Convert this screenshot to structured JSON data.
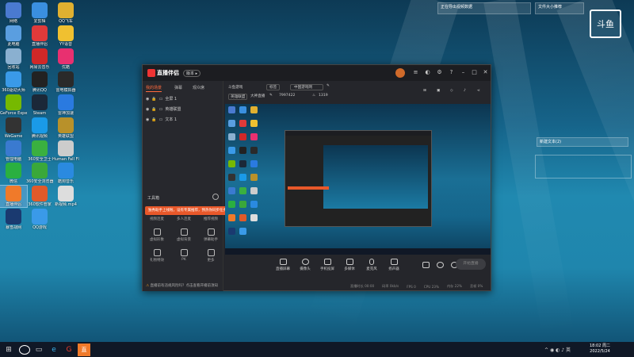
{
  "desktop_icons": [
    {
      "label": "网络",
      "color": "#4a7ad0",
      "glyph": "net"
    },
    {
      "label": "爱剪辑",
      "color": "#3a8fe0",
      "glyph": "剪"
    },
    {
      "label": "QQ飞车",
      "color": "#e0b030",
      "glyph": "Q"
    },
    {
      "label": "此电脑",
      "color": "#5a9ee0",
      "glyph": "pc"
    },
    {
      "label": "直播伴侣",
      "color": "#e03a3a",
      "glyph": "直"
    },
    {
      "label": "YY语音",
      "color": "#f0c030",
      "glyph": "Y"
    },
    {
      "label": "回收站",
      "color": "#8ab0d0",
      "glyph": "bin"
    },
    {
      "label": "网易云音乐",
      "color": "#d02828",
      "glyph": "网"
    },
    {
      "label": "优酷",
      "color": "#e83070",
      "glyph": "优"
    },
    {
      "label": "360驱动大师",
      "color": "#3a9ae8",
      "glyph": "3"
    },
    {
      "label": "腾讯QQ",
      "color": "#222",
      "glyph": "Q"
    },
    {
      "label": "雷电模拟器",
      "color": "#2a2a2a",
      "glyph": "雷"
    },
    {
      "label": "GeForce Experience",
      "color": "#76b900",
      "glyph": "G"
    },
    {
      "label": "Steam",
      "color": "#1b2838",
      "glyph": "S"
    },
    {
      "label": "雷神加速",
      "color": "#2a7ae0",
      "glyph": "雷"
    },
    {
      "label": "WeGame",
      "color": "#333",
      "glyph": "W"
    },
    {
      "label": "腾讯视频",
      "color": "#1a9ae8",
      "glyph": "▶"
    },
    {
      "label": "英雄联盟",
      "color": "#b8912a",
      "glyph": "L"
    },
    {
      "label": "管理电脑",
      "color": "#3a7ad0",
      "glyph": "pc"
    },
    {
      "label": "360安全卫士",
      "color": "#3ab040",
      "glyph": "+"
    },
    {
      "label": "Human Fall Flat",
      "color": "#ccc",
      "glyph": "H"
    },
    {
      "label": "微信",
      "color": "#2ab040",
      "glyph": "微"
    },
    {
      "label": "360安全浏览器",
      "color": "#3aa83a",
      "glyph": "e"
    },
    {
      "label": "酷狗音乐",
      "color": "#2a8ae0",
      "glyph": "K"
    },
    {
      "label": "直播伴侣",
      "color": "#f07a2a",
      "glyph": "直"
    },
    {
      "label": "360软件管家",
      "color": "#e05a2a",
      "glyph": "3"
    },
    {
      "label": "新视频.mp4",
      "color": "#ddd",
      "glyph": "mp4"
    },
    {
      "label": "暴雪战网",
      "color": "#1a3a70",
      "glyph": "B"
    },
    {
      "label": "QQ游戏",
      "color": "#3a9ae8",
      "glyph": "Q"
    }
  ],
  "app": {
    "title": "直播伴侣",
    "version_badge": "版本 ▸",
    "left_tabs": [
      "我的场景",
      "弹幕",
      "观众席"
    ],
    "scenes": [
      {
        "label": "全屏 1"
      },
      {
        "label": "英雄联盟"
      },
      {
        "label": "文本 1"
      }
    ],
    "tools_title": "工具箱",
    "tools": [
      {
        "label": "视频连麦"
      },
      {
        "label": "多人连麦"
      },
      {
        "label": "推荐视频"
      },
      {
        "label": "虚拟形象"
      },
      {
        "label": "虚拟背景"
      },
      {
        "label": "弹幕助手"
      },
      {
        "label": "礼物特效"
      },
      {
        "label": "PK"
      },
      {
        "label": "更多"
      }
    ],
    "toast": "独秀助手上线啦，设有专属推荐，预热你同步任务，有惊喜等你来领取",
    "bottom_tip": "直播前有违规风险吗？点击查看开播前须知",
    "top_info": {
      "category": "斗鱼游戏",
      "category_tag": "标签",
      "stream_title": "中国游戏网",
      "game": "英雄联盟",
      "room": "大神直播",
      "room_no": "7997422",
      "fans": "1319"
    },
    "bottom_buttons": [
      "直播屏幕",
      "摄像头",
      "手机投屏",
      "多媒体",
      "麦克风",
      "扬声器"
    ],
    "start_live": "开始直播",
    "stats": [
      "直播时长 00:00",
      "码率 0kb/s",
      "FPS 0",
      "CPU 23%",
      "内存 22%",
      "丢帧 0%"
    ]
  },
  "desktop_widgets": {
    "top_right_1": "正在导出视频数据",
    "top_right_2": "文件大小推荐",
    "right_note": "新建文本(2)",
    "brand": "斗鱼"
  },
  "taskbar": {
    "time": "18:02 周二",
    "date": "2022/5/24"
  }
}
